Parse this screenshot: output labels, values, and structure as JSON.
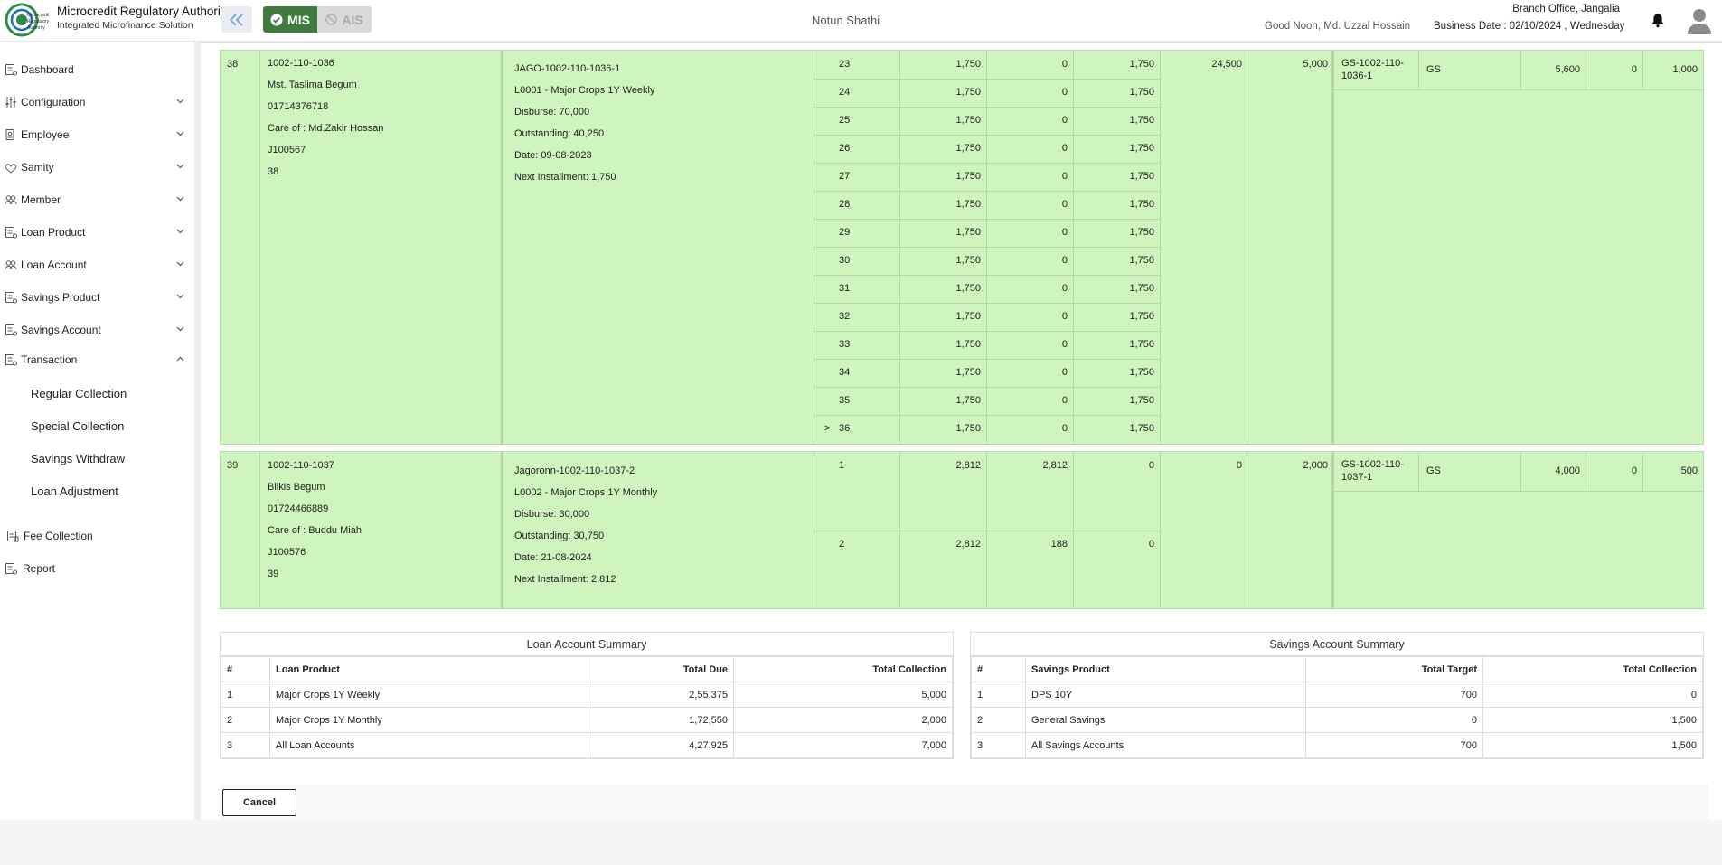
{
  "header": {
    "brand_title": "Microcredit Regulatory Authority",
    "brand_subtitle": "Integrated Microfinance Solution",
    "logo_text_1": "Microcredit",
    "logo_text_2": "Regulatory",
    "logo_text_3": "Authority",
    "mis_label": "MIS",
    "ais_label": "AIS",
    "center_title": "Notun Shathi",
    "branch": "Branch Office, Jangalia",
    "greeting": "Good Noon, Md. Uzzal Hossain",
    "business_date": "Business Date : 02/10/2024 , Wednesday",
    "accent": "#3f7b3c"
  },
  "sidebar": {
    "items": [
      {
        "label": "Dashboard",
        "icon": "dashboard-icon"
      },
      {
        "label": "Configuration",
        "icon": "sliders-icon"
      },
      {
        "label": "Employee",
        "icon": "employee-icon"
      },
      {
        "label": "Samity",
        "icon": "samity-icon"
      },
      {
        "label": "Member",
        "icon": "member-icon"
      },
      {
        "label": "Loan Product",
        "icon": "loan-product-icon"
      },
      {
        "label": "Loan Account",
        "icon": "loan-account-icon"
      },
      {
        "label": "Savings Product",
        "icon": "savings-product-icon"
      },
      {
        "label": "Savings Account",
        "icon": "savings-account-icon"
      },
      {
        "label": "Transaction",
        "icon": "transaction-icon"
      },
      {
        "label": "Fee Collection",
        "icon": "fee-icon"
      },
      {
        "label": "Report",
        "icon": "report-icon"
      }
    ],
    "transaction_sub": [
      "Regular Collection",
      "Special Collection",
      "Savings Withdraw",
      "Loan Adjustment"
    ]
  },
  "rows": {
    "r38": {
      "serial": "38",
      "member": [
        "1002-110-1036",
        "Mst. Taslima Begum",
        "01714376718",
        "Care of : Md.Zakir Hossan",
        "J100567",
        "38"
      ],
      "loan": [
        "JAGO-1002-110-1036-1",
        "L0001 - Major Crops 1Y Weekly",
        "Disburse: 70,000",
        "Outstanding: 40,250",
        "Date: 09-08-2023",
        "Next Installment: 1,750"
      ],
      "installments": [
        {
          "no": "23",
          "amount": "1,750",
          "paid": "0",
          "due": "1,750"
        },
        {
          "no": "24",
          "amount": "1,750",
          "paid": "0",
          "due": "1,750"
        },
        {
          "no": "25",
          "amount": "1,750",
          "paid": "0",
          "due": "1,750"
        },
        {
          "no": "26",
          "amount": "1,750",
          "paid": "0",
          "due": "1,750"
        },
        {
          "no": "27",
          "amount": "1,750",
          "paid": "0",
          "due": "1,750"
        },
        {
          "no": "28",
          "amount": "1,750",
          "paid": "0",
          "due": "1,750"
        },
        {
          "no": "29",
          "amount": "1,750",
          "paid": "0",
          "due": "1,750"
        },
        {
          "no": "30",
          "amount": "1,750",
          "paid": "0",
          "due": "1,750"
        },
        {
          "no": "31",
          "amount": "1,750",
          "paid": "0",
          "due": "1,750"
        },
        {
          "no": "32",
          "amount": "1,750",
          "paid": "0",
          "due": "1,750"
        },
        {
          "no": "33",
          "amount": "1,750",
          "paid": "0",
          "due": "1,750"
        },
        {
          "no": "34",
          "amount": "1,750",
          "paid": "0",
          "due": "1,750"
        },
        {
          "no": "35",
          "amount": "1,750",
          "paid": "0",
          "due": "1,750"
        },
        {
          "no": "36",
          "amount": "1,750",
          "paid": "0",
          "due": "1,750",
          "marker": ">"
        }
      ],
      "total_due": "24,500",
      "collection": "5,000",
      "savings": {
        "account": "GS-1002-110-1036-1",
        "product": "GS",
        "balance": "5,600",
        "target": "0",
        "collection": "1,000"
      }
    },
    "r39": {
      "serial": "39",
      "member": [
        "1002-110-1037",
        "Bilkis Begum",
        "01724466889",
        "Care of : Buddu Miah",
        "J100576",
        "39"
      ],
      "loan": [
        "Jagoronn-1002-110-1037-2",
        "L0002 - Major Crops 1Y Monthly",
        "Disburse: 30,000",
        "Outstanding: 30,750",
        "Date: 21-08-2024",
        "Next Installment: 2,812"
      ],
      "installments": [
        {
          "no": "1",
          "amount": "2,812",
          "paid": "2,812",
          "due": "0"
        },
        {
          "no": "2",
          "amount": "2,812",
          "paid": "188",
          "due": "0"
        }
      ],
      "total_due": "0",
      "collection": "2,000",
      "savings": {
        "account": "GS-1002-110-1037-1",
        "product": "GS",
        "balance": "4,000",
        "target": "0",
        "collection": "500"
      }
    }
  },
  "loan_summary": {
    "title": "Loan Account Summary",
    "headers": [
      "#",
      "Loan Product",
      "Total Due",
      "Total Collection"
    ],
    "rows": [
      [
        "1",
        "Major Crops 1Y Weekly",
        "2,55,375",
        "5,000"
      ],
      [
        "2",
        "Major Crops 1Y Monthly",
        "1,72,550",
        "2,000"
      ],
      [
        "3",
        "All Loan Accounts",
        "4,27,925",
        "7,000"
      ]
    ]
  },
  "savings_summary": {
    "title": "Savings Account Summary",
    "headers": [
      "#",
      "Savings Product",
      "Total Target",
      "Total Collection"
    ],
    "rows": [
      [
        "1",
        "DPS 10Y",
        "700",
        "0"
      ],
      [
        "2",
        "General Savings",
        "0",
        "1,500"
      ],
      [
        "3",
        "All Savings Accounts",
        "700",
        "1,500"
      ]
    ]
  },
  "footer": {
    "cancel_label": "Cancel"
  }
}
